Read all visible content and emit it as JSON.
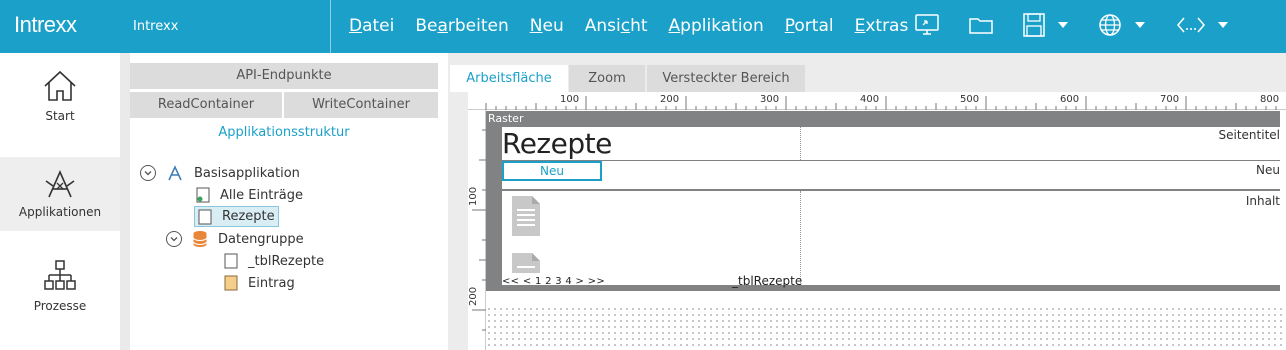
{
  "topbar": {
    "logo": "Intrexx",
    "app_name": "Intrexx",
    "menu": [
      {
        "key": "D",
        "rest": "atei",
        "pre": ""
      },
      {
        "key": "a",
        "rest": "rbeiten",
        "pre": "Be"
      },
      {
        "key": "N",
        "rest": "eu",
        "pre": ""
      },
      {
        "key": "c",
        "rest": "ht",
        "pre": "Ansi"
      },
      {
        "key": "A",
        "rest": "pplikation",
        "pre": ""
      },
      {
        "key": "P",
        "rest": "ortal",
        "pre": ""
      },
      {
        "key": "E",
        "rest": "xtras",
        "pre": ""
      }
    ],
    "tools": [
      "remote-desktop-icon",
      "folder-icon",
      "save-icon",
      "globe-icon",
      "code-icon"
    ]
  },
  "leftnav": {
    "items": [
      {
        "label": "Start",
        "icon": "home-icon"
      },
      {
        "label": "Applikationen",
        "icon": "applications-icon",
        "active": true
      },
      {
        "label": "Prozesse",
        "icon": "processes-icon"
      }
    ]
  },
  "tree_panel": {
    "tab_api": "API-Endpunkte",
    "tab_read": "ReadContainer",
    "tab_write": "WriteContainer",
    "structure_title": "Applikationsstruktur",
    "nodes": {
      "basis": "Basisapplikation",
      "alle": "Alle Einträge",
      "rezepte": "Rezepte",
      "datengruppe": "Datengruppe",
      "tbl": "_tblRezepte",
      "eintrag": "Eintrag"
    }
  },
  "editor": {
    "tabs": {
      "work": "Arbeitsfläche",
      "zoom": "Zoom",
      "hidden": "Versteckter Bereich"
    },
    "ruler_h": [
      "100",
      "200",
      "300",
      "400",
      "500",
      "600",
      "700",
      "800"
    ],
    "ruler_v": [
      "100",
      "200"
    ],
    "raster_label": "Raster",
    "page_heading": "Rezepte",
    "seitentitel_label": "Seitentitel",
    "neu_button": "Neu",
    "neu_label": "Neu",
    "inhalt_label": "Inhalt",
    "pager": "<< < 1 2 3 4 > >>",
    "table_name": "_tblRezepte"
  }
}
